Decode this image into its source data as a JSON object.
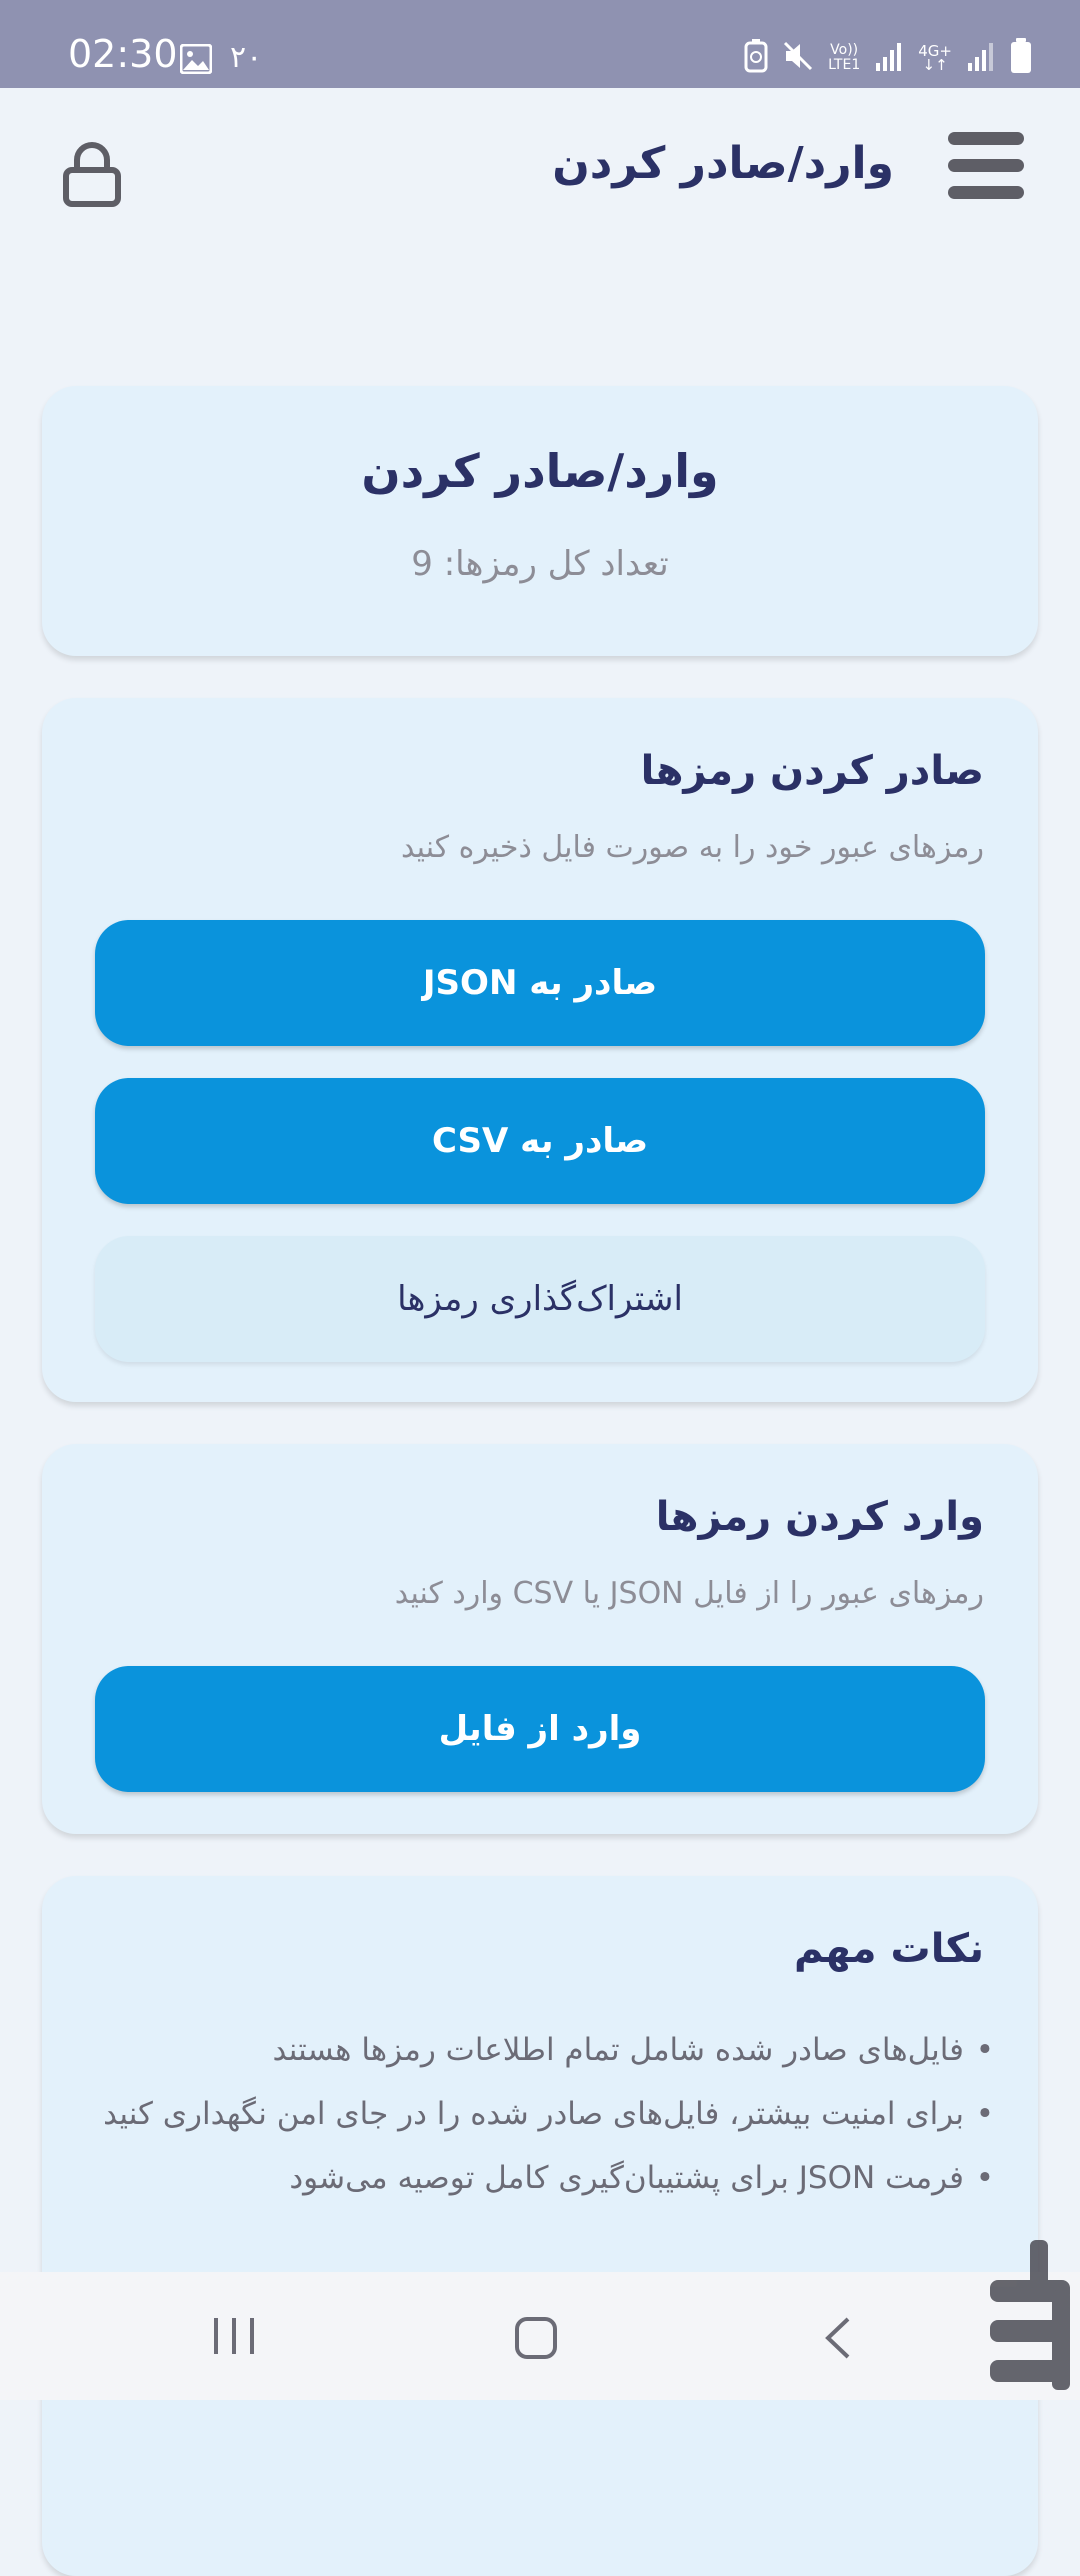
{
  "status_bar": {
    "time": "02:30",
    "notification_count": "۲۰",
    "network_label_top": "Vo))",
    "network_label_bottom": "LTE1",
    "network_type": "4G+"
  },
  "app_bar": {
    "title": "وارد/صادر کردن"
  },
  "header_card": {
    "title": "وارد/صادر کردن",
    "count_text": "تعداد کل رمزها: 9"
  },
  "export_card": {
    "title": "صادر کردن رمزها",
    "description": "رمزهای عبور خود را به صورت فایل ذخیره کنید",
    "json_button": "صادر به JSON",
    "csv_button": "صادر به CSV",
    "share_button": "اشتراک‌گذاری رمزها"
  },
  "import_card": {
    "title": "وارد کردن رمزها",
    "description": "رمزهای عبور را از فایل JSON یا CSV وارد کنید",
    "import_button": "وارد از فایل"
  },
  "tips_card": {
    "title": "نکات مهم",
    "items": [
      "فایل‌های صادر شده شامل تمام اطلاعات رمزها هستند",
      "برای امنیت بیشتر، فایل‌های صادر شده را در جای امن نگهداری کنید",
      "فرمت JSON برای پشتیبان‌گیری کامل توصیه می‌شود"
    ]
  },
  "colors": {
    "primary": "#0a93dc",
    "card_bg": "#e3f1fb",
    "title_text": "#2b3166",
    "status_bar": "#8f92b1"
  }
}
